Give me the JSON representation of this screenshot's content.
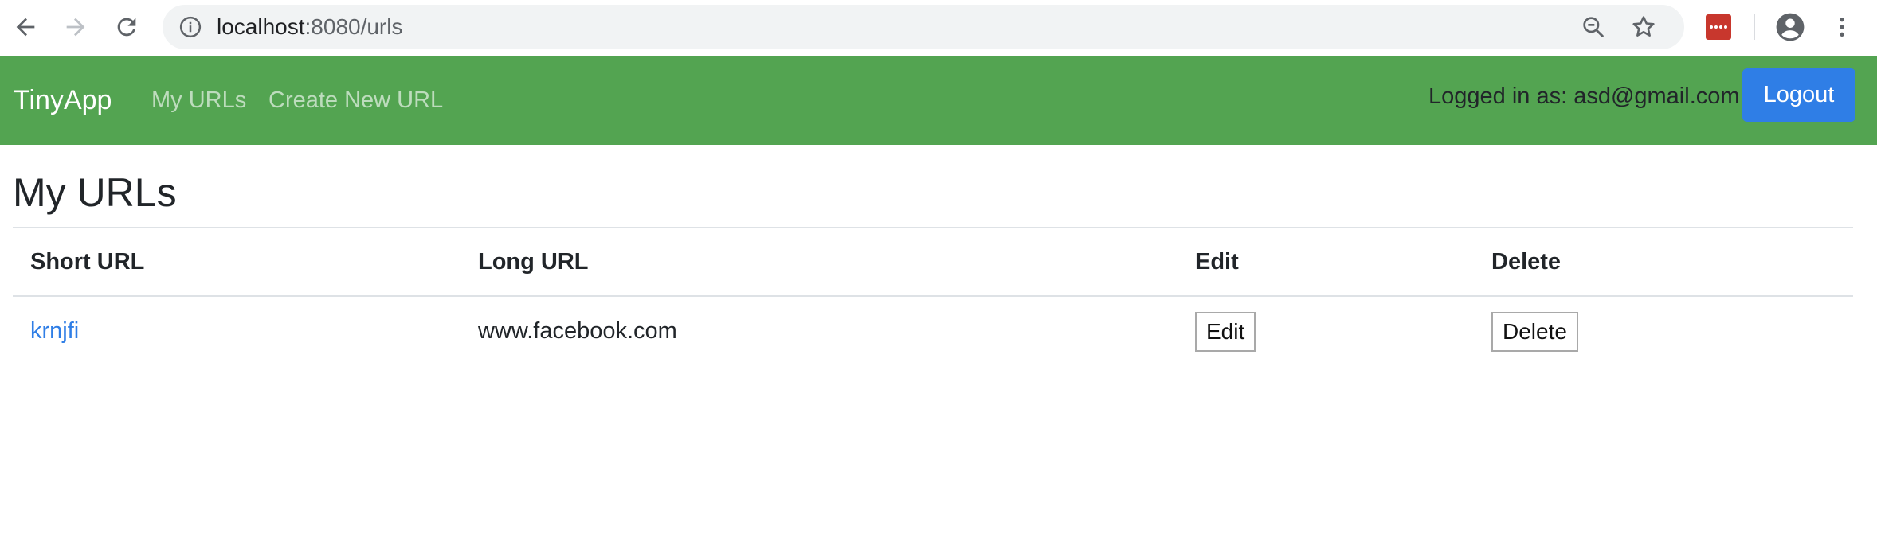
{
  "browser": {
    "url_host": "localhost",
    "url_path": ":8080/urls"
  },
  "navbar": {
    "brand": "TinyApp",
    "links": [
      "My URLs",
      "Create New URL"
    ],
    "logged_in_text": "Logged in as: asd@gmail.com",
    "logout_label": "Logout"
  },
  "page": {
    "title": "My URLs"
  },
  "table": {
    "headers": [
      "Short URL",
      "Long URL",
      "Edit",
      "Delete"
    ],
    "rows": [
      {
        "short_url": "krnjfi",
        "long_url": "www.facebook.com",
        "edit_label": "Edit",
        "delete_label": "Delete"
      }
    ]
  },
  "colors": {
    "navbar": "#53a451",
    "primary": "#2f7ee6",
    "extension": "#c8372d"
  },
  "icons": [
    "back-arrow-icon",
    "forward-arrow-icon",
    "reload-icon",
    "info-icon",
    "zoom-out-icon",
    "star-icon",
    "extension-icon",
    "account-icon",
    "menu-icon"
  ]
}
